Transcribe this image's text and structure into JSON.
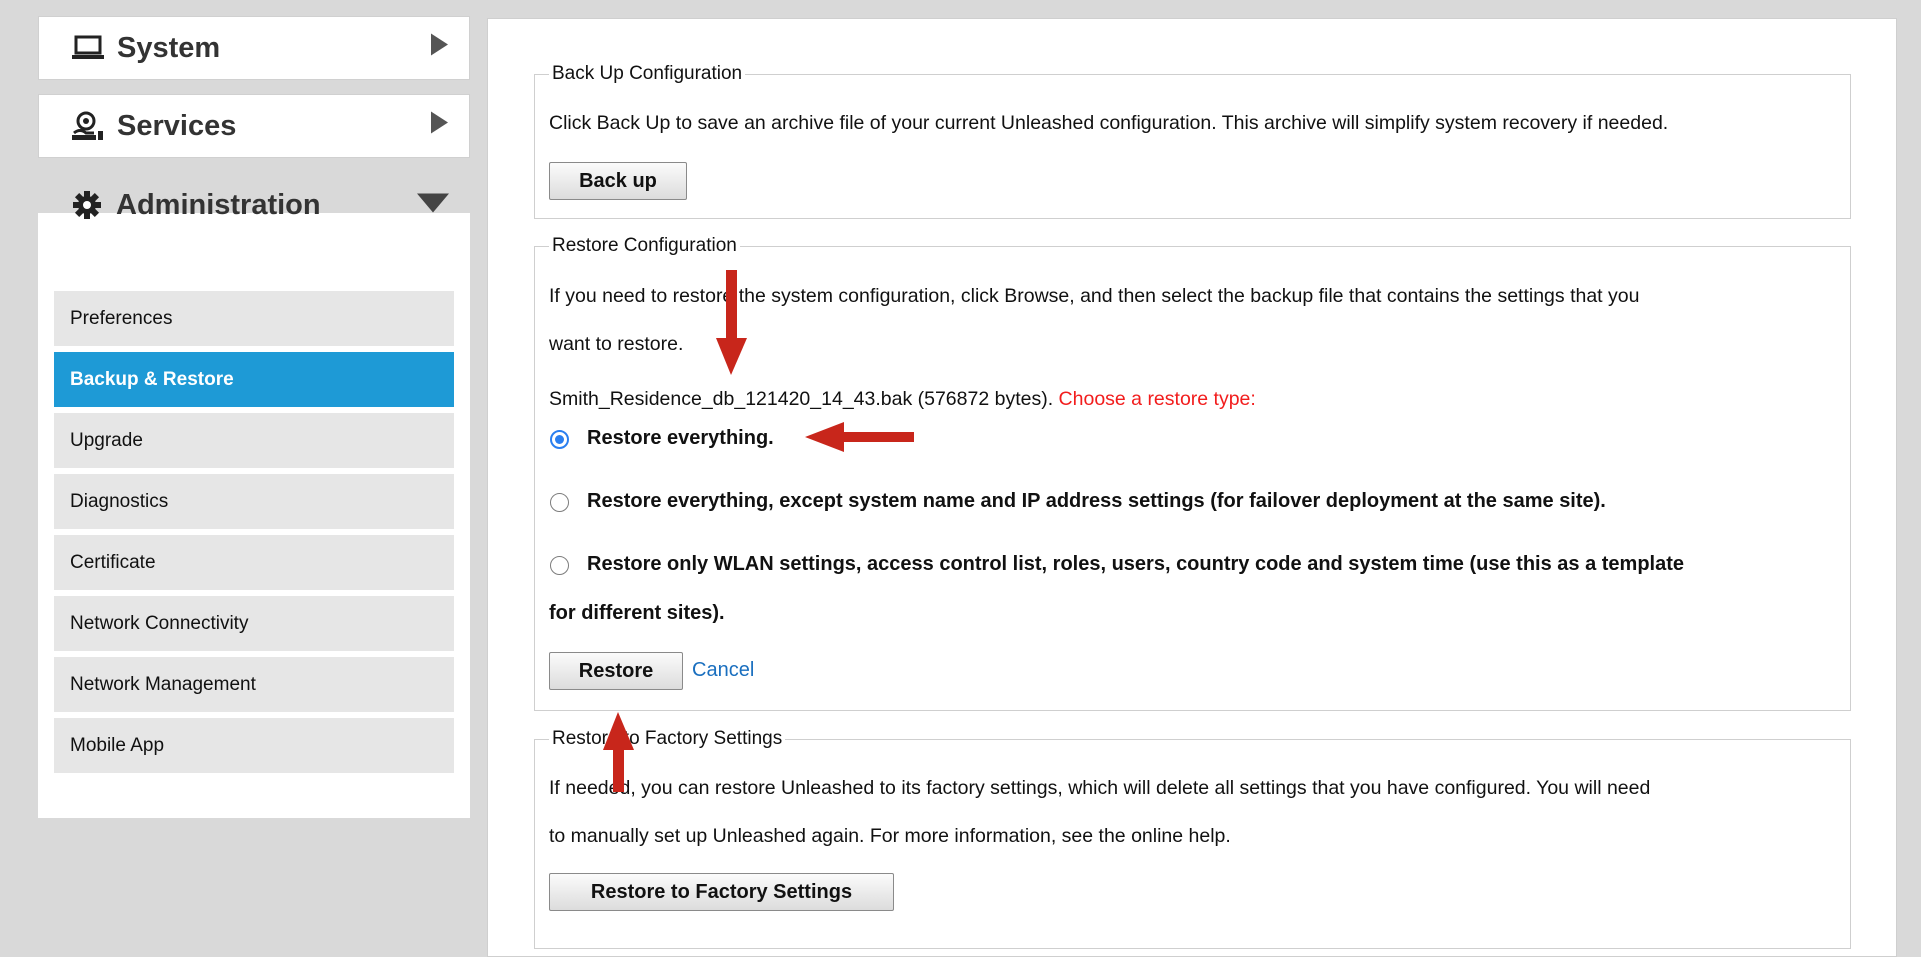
{
  "sidebar": {
    "system": {
      "label": "System",
      "icon": "laptop-icon"
    },
    "services": {
      "label": "Services",
      "icon": "services-icon"
    },
    "administration": {
      "label": "Administration",
      "icon": "gear-icon"
    },
    "items": [
      {
        "label": "Preferences"
      },
      {
        "label": "Backup & Restore",
        "active": true
      },
      {
        "label": "Upgrade"
      },
      {
        "label": "Diagnostics"
      },
      {
        "label": "Certificate"
      },
      {
        "label": "Network Connectivity"
      },
      {
        "label": "Network Management"
      },
      {
        "label": "Mobile App"
      }
    ]
  },
  "backup": {
    "legend": "Back Up Configuration",
    "description": "Click Back Up to save an archive file of your current Unleashed configuration. This archive will simplify system recovery if needed.",
    "button": "Back up"
  },
  "restore": {
    "legend": "Restore Configuration",
    "description_line1": "If you need to restore the system configuration, click Browse, and then select the backup file that contains the settings that you",
    "description_line2": "want to restore.",
    "file_info": "Smith_Residence_db_121420_14_43.bak (576872 bytes).",
    "choose_prompt": "Choose a restore type:",
    "options": [
      {
        "label": "Restore everything.",
        "selected": true
      },
      {
        "label": "Restore everything, except system name and IP address settings (for failover deployment at the same site).",
        "selected": false
      },
      {
        "label_line1": "Restore only WLAN settings, access control list, roles, users, country code and system time (use this as a template",
        "label_line2": "for different sites).",
        "selected": false
      }
    ],
    "button": "Restore",
    "cancel": "Cancel"
  },
  "factory": {
    "legend": "Restore to Factory Settings",
    "description_line1": "If needed, you can restore Unleashed to its factory settings, which will delete all settings that you have configured. You will need",
    "description_line2": "to manually set up Unleashed again. For more information, see the online help.",
    "button": "Restore to Factory Settings"
  },
  "colors": {
    "accent": "#1e9ad6",
    "annotation_arrow": "#c8261b",
    "warning_text": "#f21d1d",
    "link": "#1a6fbf"
  }
}
